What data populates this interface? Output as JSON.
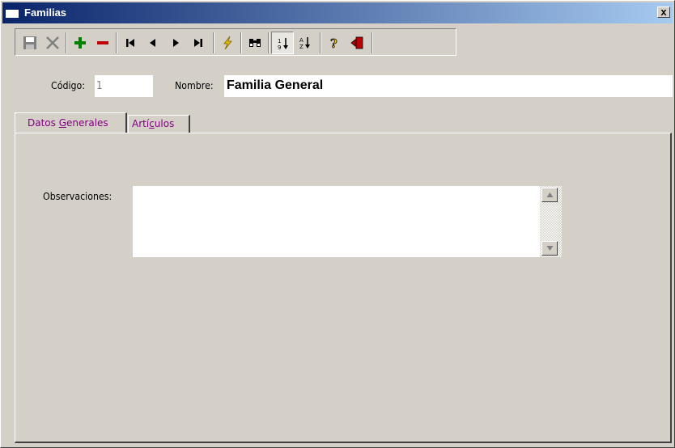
{
  "window": {
    "title": "Familias",
    "close_label": "x"
  },
  "form": {
    "codigo_label": "Código:",
    "codigo_value": "1",
    "nombre_label": "Nombre:",
    "nombre_value": "Familia General"
  },
  "tabs": [
    {
      "label": "Datos Generales",
      "accel": "G",
      "active": true
    },
    {
      "label": "Artículos",
      "accel": "c",
      "active": false
    }
  ],
  "panel": {
    "observaciones_label": "Observaciones:",
    "observaciones_value": ""
  },
  "toolbar": {
    "buttons": [
      "save-icon",
      "cancel-icon",
      "add-icon",
      "delete-icon",
      "first-record-icon",
      "previous-record-icon",
      "next-record-icon",
      "last-record-icon",
      "lightning-icon",
      "binoculars-icon",
      "sort-numeric-icon",
      "sort-alpha-icon",
      "help-icon",
      "exit-icon"
    ],
    "colors": {
      "add": "#008000",
      "delete": "#c00000",
      "lightning": "#e0c000",
      "exit": "#c00000"
    }
  }
}
